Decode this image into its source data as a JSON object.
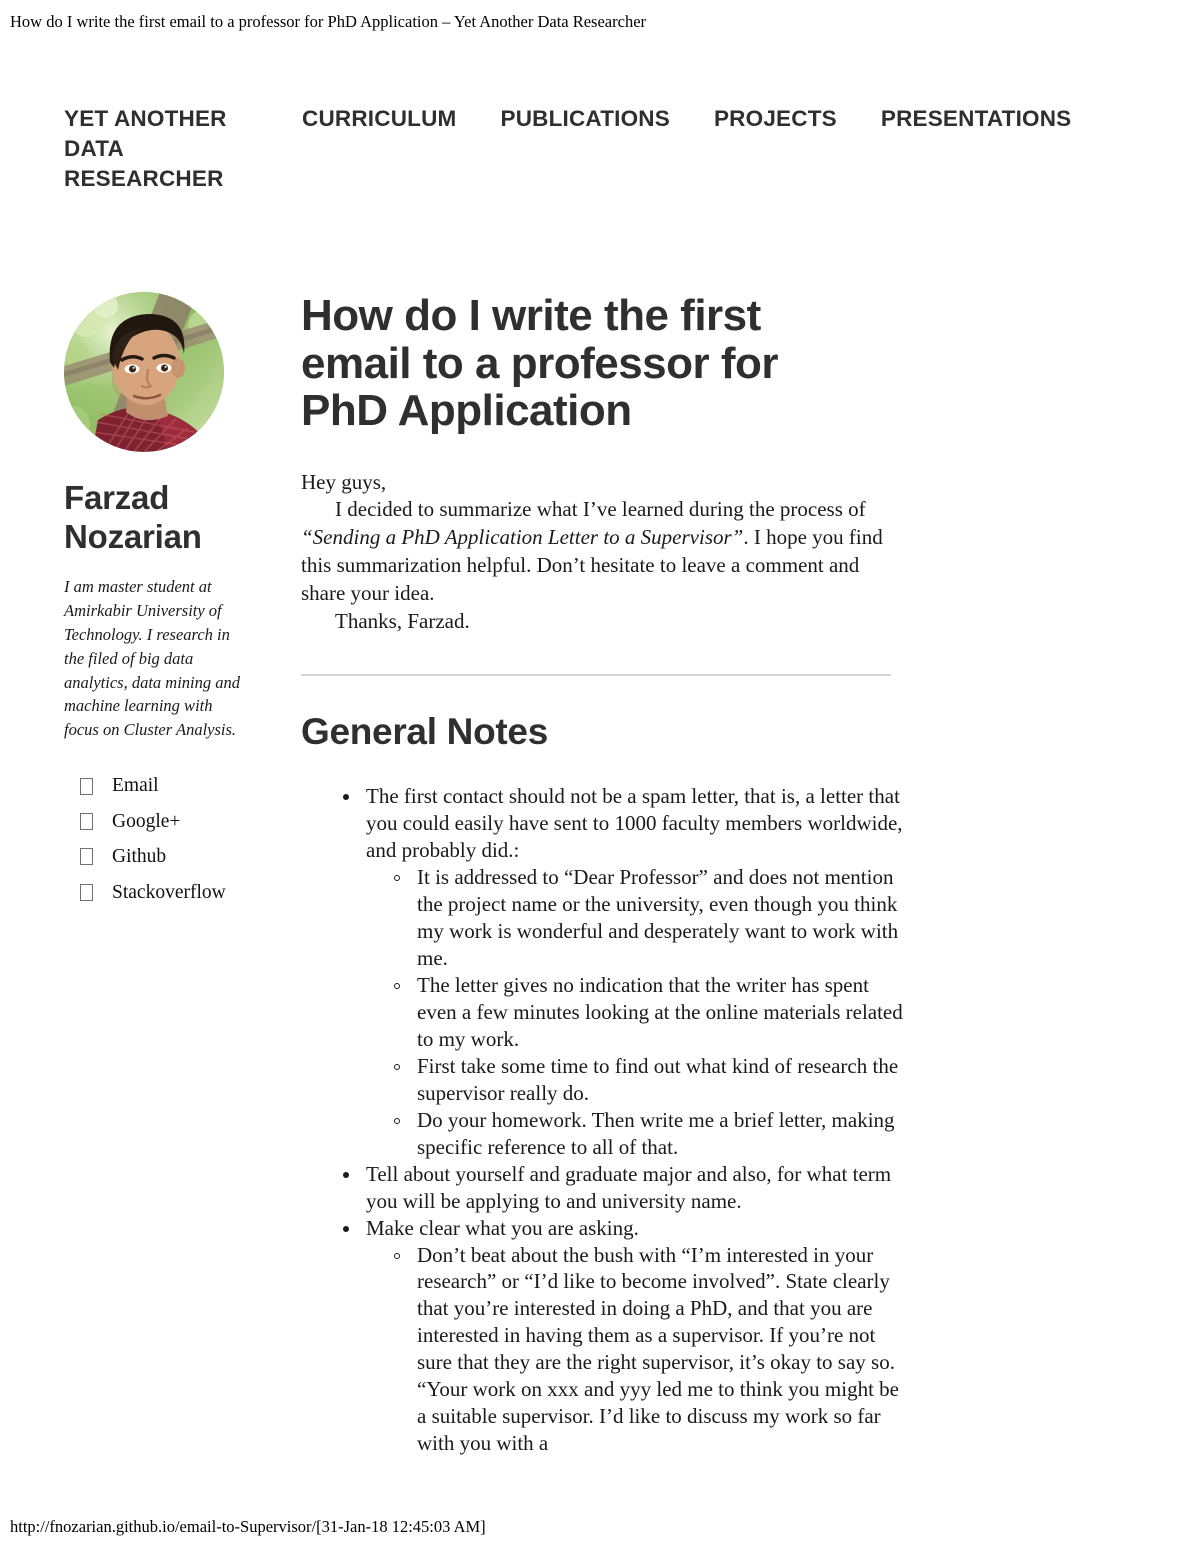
{
  "print": {
    "header_title": "How do I write the first email to a professor for PhD Application – Yet Another Data Researcher",
    "footer_text": "http://fnozarian.github.io/email-to-Supervisor/[31-Jan-18 12:45:03 AM]"
  },
  "nav": {
    "brand": "YET ANOTHER DATA RESEARCHER",
    "links": [
      {
        "label": "CURRICULUM"
      },
      {
        "label": "PUBLICATIONS"
      },
      {
        "label": "PROJECTS"
      },
      {
        "label": "PRESENTATIONS"
      }
    ]
  },
  "sidebar": {
    "avatar_alt": "Farzad Nozarian portrait",
    "name": "Farzad Nozarian",
    "bio": "I am master student at Amirkabir University of Technology. I research in the filed of big data analytics, data mining and machine learning with focus on Cluster Analysis.",
    "social": [
      {
        "icon": "email-icon",
        "label": "Email"
      },
      {
        "icon": "googleplus-icon",
        "label": "Google+"
      },
      {
        "icon": "github-icon",
        "label": "Github"
      },
      {
        "icon": "stackoverflow-icon",
        "label": "Stackoverflow"
      }
    ]
  },
  "post": {
    "title": "How do I write the first email to a professor for PhD Application",
    "intro_greeting": "Hey guys,",
    "intro_line_a": "I decided to summarize what I’ve learned during the process of ",
    "intro_quote": "“Sending a PhD Application Letter to a Supervisor”",
    "intro_line_b": ". I hope you find this summarization helpful. Don’t hesitate to leave a comment and share your idea.",
    "intro_signoff": "Thanks, Farzad.",
    "section_heading": "General Notes",
    "notes": [
      {
        "text": "The first contact should not be a spam letter, that is, a letter that you could easily have sent to 1000 faculty members worldwide, and probably did.:",
        "children": [
          {
            "text": "It is addressed to “Dear Professor” and does not mention the project name or the university, even though you think my work is wonderful and desperately want to work with me."
          },
          {
            "text": "The letter gives no indication that the writer has spent even a few minutes looking at the online materials related to my work."
          },
          {
            "text": "First take some time to find out what kind of research the supervisor really do."
          },
          {
            "text": "Do your homework. Then write me a brief letter, making specific reference to all of that."
          }
        ]
      },
      {
        "text": "Tell about yourself and graduate major and also, for what term you will be applying to and university name.",
        "children": []
      },
      {
        "text": "Make clear what you are asking.",
        "children": [
          {
            "text": "Don’t beat about the bush with “I’m interested in your research” or “I’d like to become involved”. State clearly that you’re interested in doing a PhD, and that you are interested in having them as a supervisor. If you’re not sure that they are the right supervisor, it’s okay to say so. “Your work on xxx and yyy led me to think you might be a suitable supervisor. I’d like to discuss my work so far with you with a"
          }
        ]
      }
    ]
  },
  "colors": {
    "heading": "#2f2f2f",
    "body": "#1a1a1a",
    "rule": "#d4d4d4"
  }
}
